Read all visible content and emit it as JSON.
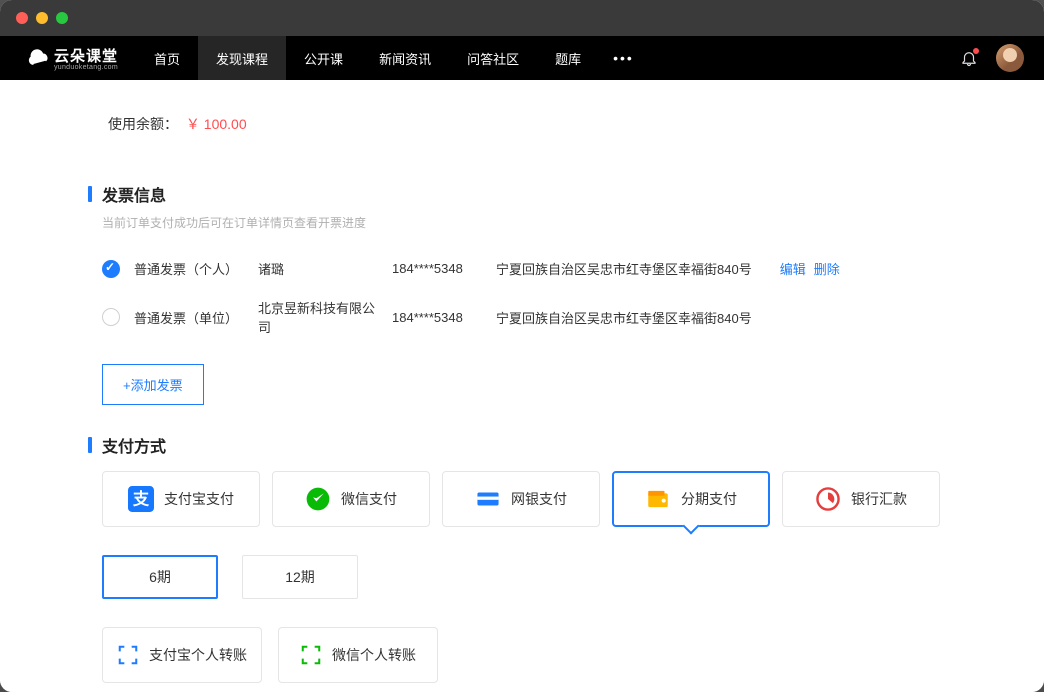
{
  "logo": {
    "title": "云朵课堂",
    "sub": "yunduoketang.com"
  },
  "nav": {
    "items": [
      "首页",
      "发现课程",
      "公开课",
      "新闻资讯",
      "问答社区",
      "题库"
    ],
    "activeIndex": 1
  },
  "balance": {
    "label": "使用余额：",
    "amount": "￥ 100.00"
  },
  "invoice": {
    "title": "发票信息",
    "sub": "当前订单支付成功后可在订单详情页查看开票进度",
    "rows": [
      {
        "type": "普通发票（个人）",
        "name": "诸璐",
        "phone": "184****5348",
        "addr": "宁夏回族自治区吴忠市红寺堡区幸福街840号",
        "selected": true
      },
      {
        "type": "普通发票（单位）",
        "name": "北京昱新科技有限公司",
        "phone": "184****5348",
        "addr": "宁夏回族自治区吴忠市红寺堡区幸福街840号",
        "selected": false
      }
    ],
    "actions": {
      "edit": "编辑",
      "del": "删除"
    },
    "add": "+添加发票"
  },
  "payment": {
    "title": "支付方式",
    "methods": [
      {
        "label": "支付宝支付",
        "icon": "alipay"
      },
      {
        "label": "微信支付",
        "icon": "wechat"
      },
      {
        "label": "网银支付",
        "icon": "bankcard"
      },
      {
        "label": "分期支付",
        "icon": "wallet",
        "selected": true
      },
      {
        "label": "银行汇款",
        "icon": "banklogo"
      }
    ],
    "terms": [
      {
        "label": "6期",
        "selected": true
      },
      {
        "label": "12期",
        "selected": false
      }
    ],
    "transfers": [
      {
        "label": "支付宝个人转账",
        "icon": "scan-blue"
      },
      {
        "label": "微信个人转账",
        "icon": "scan-green"
      }
    ]
  }
}
